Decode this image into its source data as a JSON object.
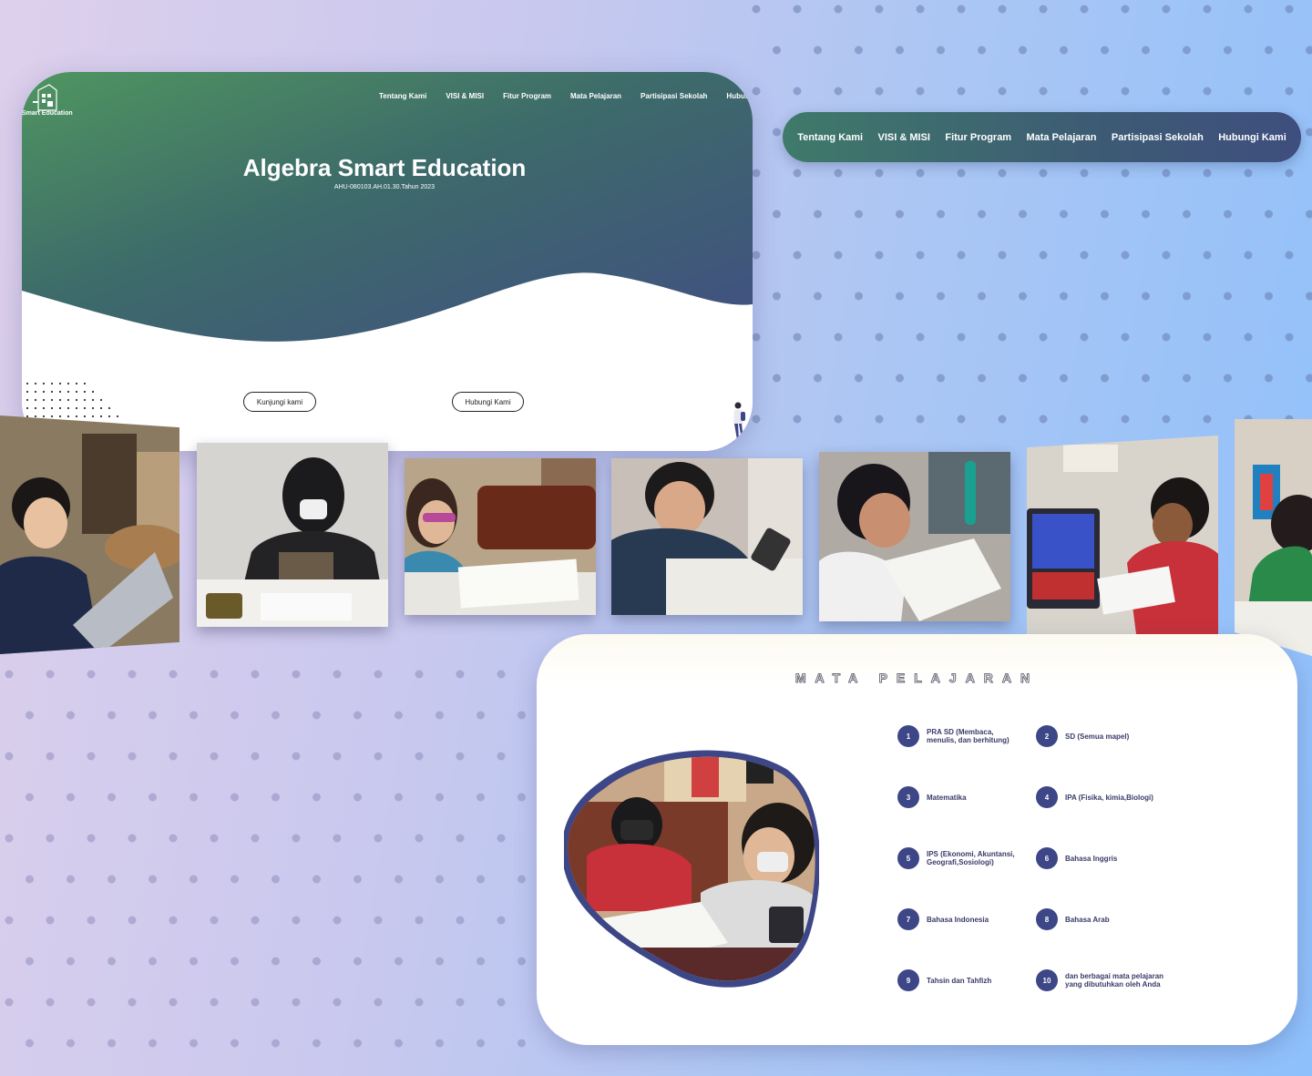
{
  "hero": {
    "logo_text": "Smart Education",
    "nav": [
      "Tentang Kami",
      "VISI & MISI",
      "Fitur Program",
      "Mata Pelajaran",
      "Partisipasi Sekolah",
      "Hubungi"
    ],
    "title": "Algebra Smart Education",
    "subtitle": "AHU-080103.AH.01.30.Tahun 2023",
    "button_visit": "Kunjungi kami",
    "button_contact": "Hubungi Kami"
  },
  "float_nav": [
    "Tentang Kami",
    "VISI & MISI",
    "Fitur Program",
    "Mata Pelajaran",
    "Partisipasi Sekolah",
    "Hubungi Kami"
  ],
  "subjects": {
    "title": "MATA PELAJARAN",
    "items": [
      {
        "num": "1",
        "label": "PRA SD (Membaca, menulis, dan berhitung)"
      },
      {
        "num": "2",
        "label": "SD (Semua mapel)"
      },
      {
        "num": "3",
        "label": "Matematika"
      },
      {
        "num": "4",
        "label": "IPA (Fisika, kimia,Biologi)"
      },
      {
        "num": "5",
        "label": "IPS (Ekonomi, Akuntansi, Geografi,Sosiologi)"
      },
      {
        "num": "6",
        "label": "Bahasa Inggris"
      },
      {
        "num": "7",
        "label": "Bahasa Indonesia"
      },
      {
        "num": "8",
        "label": "Bahasa Arab"
      },
      {
        "num": "9",
        "label": "Tahsin dan Tahfizh"
      },
      {
        "num": "10",
        "label": "dan berbagai mata pelajaran yang dibutuhkan oleh Anda"
      }
    ]
  },
  "colors": {
    "accent": "#3d4686",
    "hero_green": "#4f9560",
    "hero_blue": "#414f82"
  }
}
